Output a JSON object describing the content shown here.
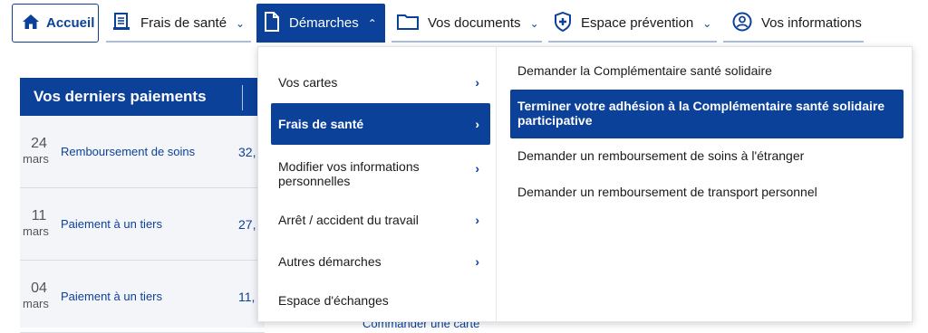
{
  "nav": {
    "home": "Accueil",
    "frais": "Frais de santé",
    "demarches": "Démarches",
    "documents": "Vos documents",
    "prevention": "Espace prévention",
    "informations": "Vos informations"
  },
  "payments": {
    "title": "Vos derniers paiements",
    "rows": [
      {
        "day": "24",
        "month": "mars",
        "label": "Remboursement de soins",
        "amount": "32,"
      },
      {
        "day": "11",
        "month": "mars",
        "label": "Paiement à un tiers",
        "amount": "27,"
      },
      {
        "day": "04",
        "month": "mars",
        "label": "Paiement à un tiers",
        "amount": "11,"
      }
    ],
    "bottom_link": "Commander une carte"
  },
  "menu": {
    "submenu": [
      {
        "label": "Vos cartes"
      },
      {
        "label": "Frais de santé"
      },
      {
        "label": "Modifier vos informations personnelles"
      },
      {
        "label": "Arrêt / accident du travail"
      },
      {
        "label": "Autres démarches"
      },
      {
        "label": "Espace d'échanges"
      }
    ],
    "actions": [
      {
        "label": "Demander la Complémentaire santé solidaire"
      },
      {
        "label": "Terminer votre adhésion à la Complémentaire santé solidaire participative"
      },
      {
        "label": "Demander un remboursement de soins à l'étranger"
      },
      {
        "label": "Demander un remboursement de transport personnel"
      }
    ]
  },
  "colors": {
    "accent": "#0c419a"
  }
}
